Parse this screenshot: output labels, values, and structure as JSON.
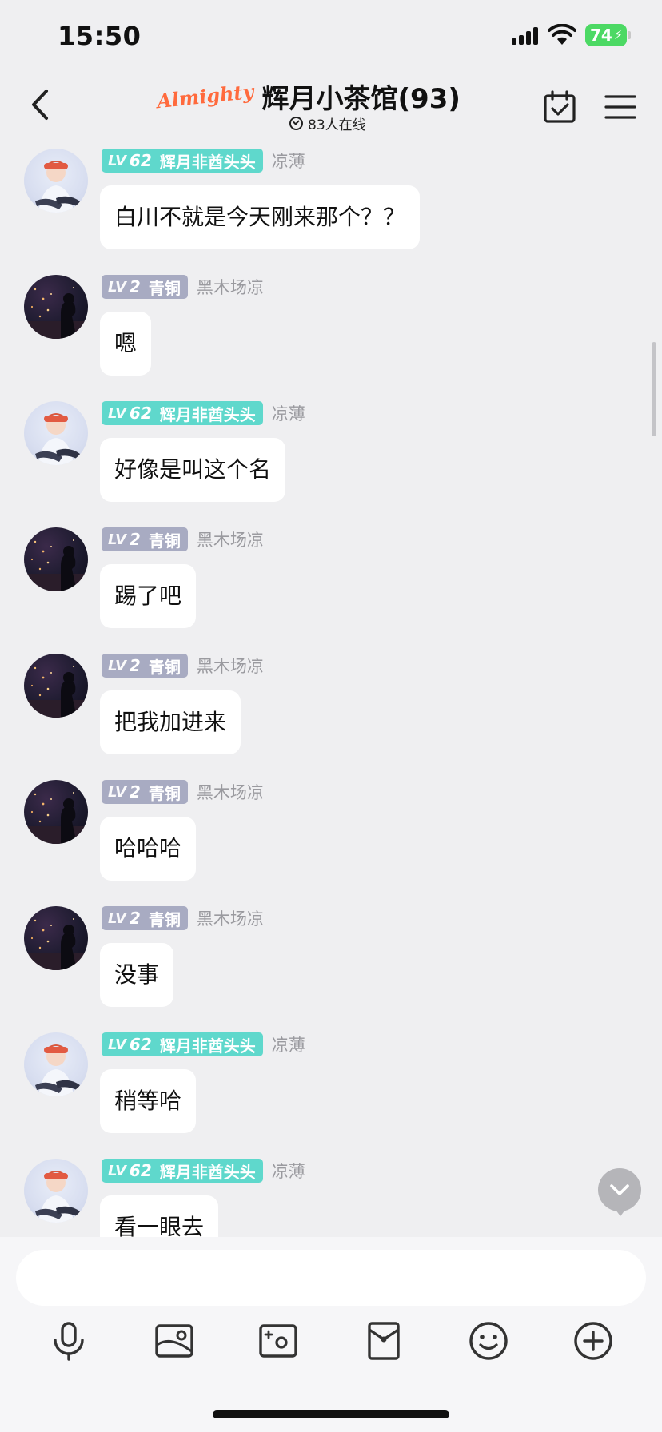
{
  "status": {
    "time": "15:50",
    "battery": "74"
  },
  "header": {
    "badge": "Almighty",
    "title": "辉月小茶馆(93)",
    "online": "83人在线"
  },
  "colors": {
    "tag_teal": "#5fd8cc",
    "tag_gray": "#a8abc2",
    "battery": "#4cd964"
  },
  "messages": [
    {
      "lv": "LV",
      "level": "62",
      "rank": "辉月非酋头头",
      "sender": "凉薄",
      "text": "白川不就是今天刚来那个？？",
      "tag_style": "teal",
      "avatar": "girl-avatar"
    },
    {
      "lv": "LV",
      "level": "2",
      "rank": "青铜",
      "sender": "黑木场凉",
      "text": "嗯",
      "tag_style": "gray",
      "avatar": "night-city-avatar"
    },
    {
      "lv": "LV",
      "level": "62",
      "rank": "辉月非酋头头",
      "sender": "凉薄",
      "text": "好像是叫这个名",
      "tag_style": "teal",
      "avatar": "girl-avatar"
    },
    {
      "lv": "LV",
      "level": "2",
      "rank": "青铜",
      "sender": "黑木场凉",
      "text": "踢了吧",
      "tag_style": "gray",
      "avatar": "night-city-avatar"
    },
    {
      "lv": "LV",
      "level": "2",
      "rank": "青铜",
      "sender": "黑木场凉",
      "text": "把我加进来",
      "tag_style": "gray",
      "avatar": "night-city-avatar"
    },
    {
      "lv": "LV",
      "level": "2",
      "rank": "青铜",
      "sender": "黑木场凉",
      "text": "哈哈哈",
      "tag_style": "gray",
      "avatar": "night-city-avatar"
    },
    {
      "lv": "LV",
      "level": "2",
      "rank": "青铜",
      "sender": "黑木场凉",
      "text": "没事",
      "tag_style": "gray",
      "avatar": "night-city-avatar"
    },
    {
      "lv": "LV",
      "level": "62",
      "rank": "辉月非酋头头",
      "sender": "凉薄",
      "text": "稍等哈",
      "tag_style": "teal",
      "avatar": "girl-avatar"
    },
    {
      "lv": "LV",
      "level": "62",
      "rank": "辉月非酋头头",
      "sender": "凉薄",
      "text": "看一眼去",
      "tag_style": "teal",
      "avatar": "girl-avatar"
    }
  ],
  "composer": {
    "input_value": "",
    "tools": [
      "microphone-icon",
      "image-icon",
      "camera-icon",
      "red-packet-icon",
      "emoji-icon",
      "plus-icon"
    ]
  }
}
